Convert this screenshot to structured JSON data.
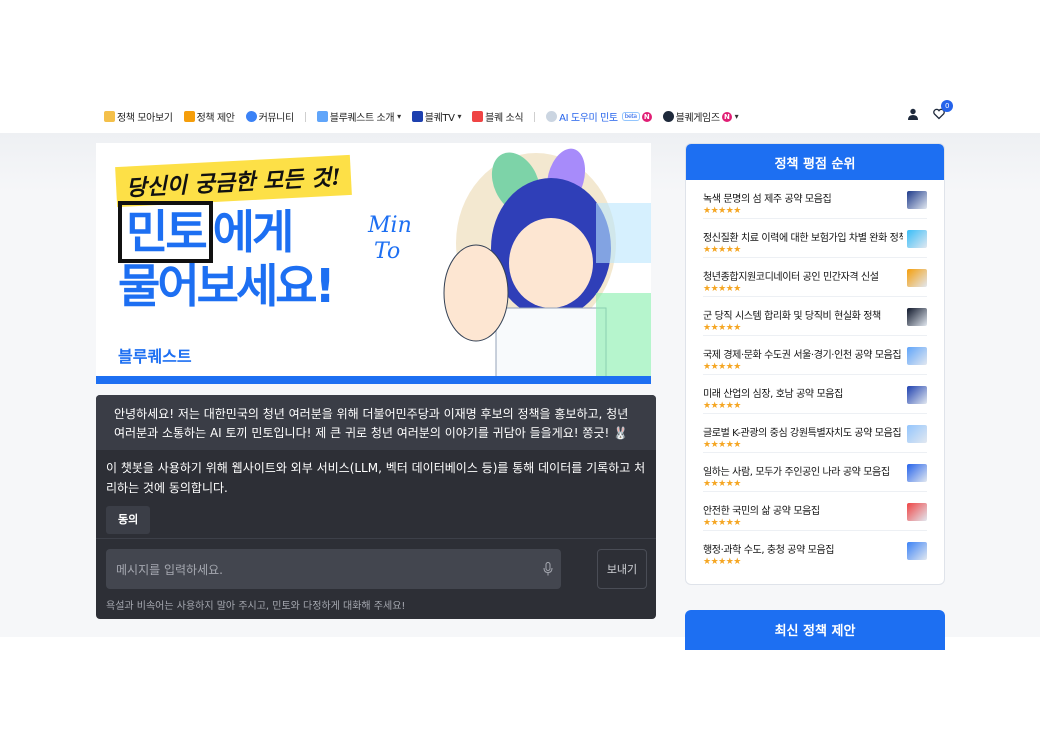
{
  "nav": {
    "items": [
      {
        "label": "정책 모아보기",
        "icon": "folder-icon"
      },
      {
        "label": "정책 제안",
        "icon": "pencil-icon"
      },
      {
        "label": "커뮤니티",
        "icon": "people-icon"
      }
    ],
    "items2": [
      {
        "label": "블루퀘스트 소개",
        "icon": "square-icon"
      },
      {
        "label": "블퀘TV",
        "icon": "tv-icon"
      },
      {
        "label": "블퀘 소식",
        "icon": "megaphone-icon"
      }
    ],
    "mint": {
      "label": "AI 도우미 민토",
      "beta": "beta",
      "badge": "N"
    },
    "games": {
      "label": "블퀘게임즈",
      "badge": "N"
    },
    "cart_count": "0"
  },
  "banner": {
    "tagline": "당신이 궁금한 모든 것!",
    "headline_box": "민토",
    "headline_rest": "에게",
    "headline_line2": "물어보세요!",
    "mint_line1": "Min",
    "mint_line2": "To",
    "logo": "블루퀘스트"
  },
  "chat": {
    "greeting": "안녕하세요! 저는 대한민국의 청년 여러분을 위해 더불어민주당과 이재명 후보의 정책을 홍보하고, 청년 여러분과 소통하는 AI 토끼 민토입니다! 제 큰 귀로 청년 여러분의 이야기를 귀담아 들을게요! 쫑긋! 🐰",
    "consent": "이 챗봇을 사용하기 위해 웹사이트와 외부 서비스(LLM, 벡터 데이터베이스 등)를 통해 데이터를 기록하고 처리하는 것에 동의합니다.",
    "agree_label": "동의",
    "input_placeholder": "메시지를 입력하세요.",
    "send_label": "보내기",
    "note": "욕설과 비속어는 사용하지 말아 주시고, 민토와 다정하게 대화해 주세요!"
  },
  "sidebar": {
    "title": "정책 평점 순위",
    "stars": "★★★★★",
    "items": [
      {
        "title": "녹색 문명의 섬 제주 공약 모음집"
      },
      {
        "title": "정신질환 치료 이력에 대한 보험가입 차별 완화 정책"
      },
      {
        "title": "청년종합지원코디네이터 공인 민간자격 신설"
      },
      {
        "title": "군 당직 시스템 합리화 및 당직비 현실화 정책"
      },
      {
        "title": "국제 경제·문화 수도권 서울·경기·인천 공약 모음집"
      },
      {
        "title": "미래 산업의 심장, 호남 공약 모음집"
      },
      {
        "title": "글로벌 K-관광의 중심 강원특별자치도 공약 모음집"
      },
      {
        "title": "일하는 사람, 모두가 주인공인 나라 공약 모음집"
      },
      {
        "title": "안전한 국민의 삶 공약 모음집"
      },
      {
        "title": "행정·과학 수도, 충청 공약 모음집"
      }
    ],
    "section2_title": "최신 정책 제안"
  }
}
